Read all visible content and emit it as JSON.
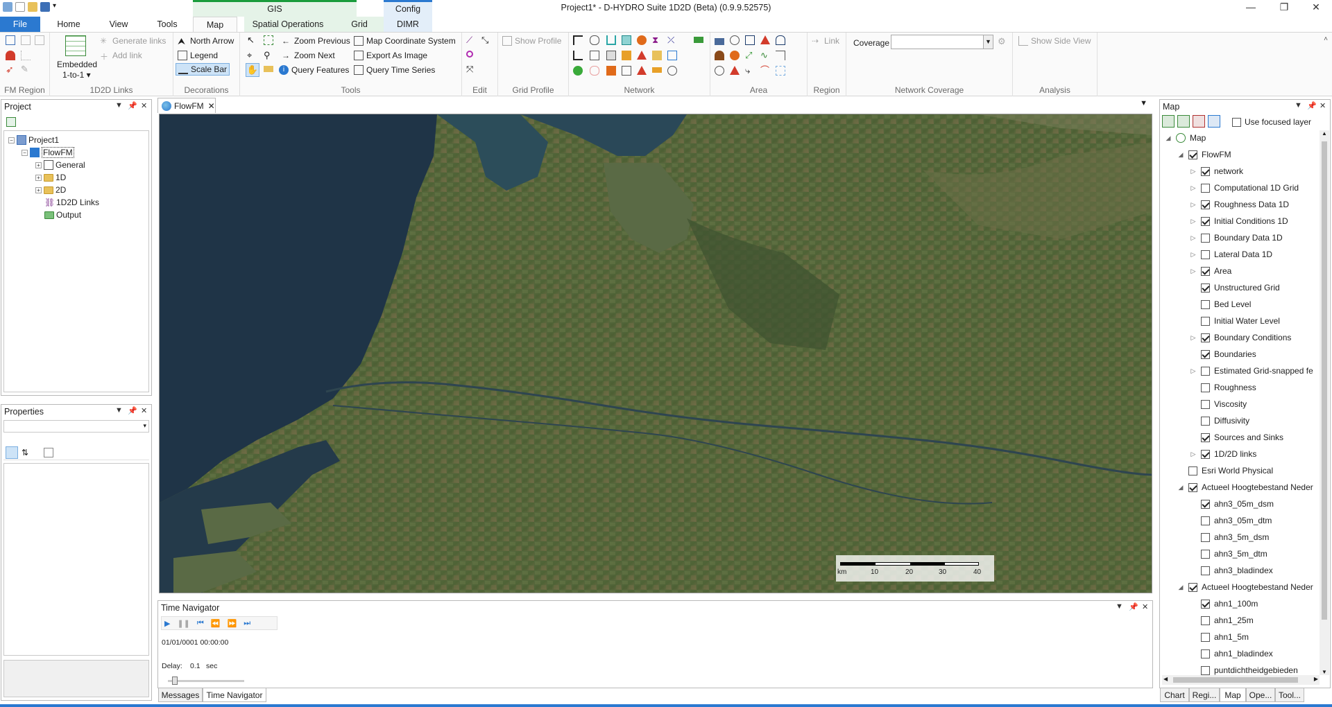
{
  "window": {
    "title": "Project1* - D-HYDRO Suite 1D2D (Beta) (0.9.9.52575)"
  },
  "contextual_heads": {
    "gis": "GIS",
    "config": "Config"
  },
  "tabs": [
    "File",
    "Home",
    "View",
    "Tools",
    "Map",
    "Spatial Operations",
    "Grid",
    "DIMR"
  ],
  "ribbon": {
    "fm_region": {
      "label": "FM Region"
    },
    "links": {
      "embedded": "Embedded",
      "mode": "1-to-1 ▾",
      "generate": "Generate links",
      "add": "Add link",
      "label": "1D2D Links"
    },
    "decorations": {
      "north_arrow": "North Arrow",
      "legend": "Legend",
      "scale_bar": "Scale Bar",
      "label": "Decorations"
    },
    "tools": {
      "zoom_previous": "Zoom Previous",
      "zoom_next": "Zoom Next",
      "query_features": "Query Features",
      "map_coordinate_system": "Map Coordinate System",
      "export_as_image": "Export As Image",
      "query_time_series": "Query Time Series",
      "label": "Tools"
    },
    "edit": {
      "label": "Edit"
    },
    "grid_profile": {
      "show_profile": "Show Profile",
      "label": "Grid Profile"
    },
    "network": {
      "label": "Network"
    },
    "area": {
      "label": "Area"
    },
    "region": {
      "link": "Link",
      "label": "Region"
    },
    "network_coverage": {
      "coverage_label": "Coverage",
      "coverage_value": "",
      "label": "Network Coverage"
    },
    "analysis": {
      "show_side_view": "Show Side View",
      "label": "Analysis"
    }
  },
  "project": {
    "title": "Project",
    "root": "Project1",
    "model": "FlowFM",
    "children": [
      "General",
      "1D",
      "2D",
      "1D2D Links",
      "Output"
    ]
  },
  "properties": {
    "title": "Properties"
  },
  "document_tab": {
    "label": "FlowFM"
  },
  "scale_bar": {
    "unit": "km",
    "ticks": [
      "10",
      "20",
      "30",
      "40"
    ]
  },
  "time_navigator": {
    "title": "Time Navigator",
    "time": "01/01/0001 00:00:00",
    "delay_label": "Delay:",
    "delay_value": "0.1",
    "delay_unit": "sec",
    "slider_fraction": 0.05
  },
  "map_panel": {
    "title": "Map",
    "use_focused_layer": "Use focused layer",
    "layers": [
      {
        "label": "Map",
        "indent": 0,
        "expander": "◢",
        "checkbox": null
      },
      {
        "label": "FlowFM",
        "indent": 1,
        "expander": "◢",
        "checkbox": true
      },
      {
        "label": "network",
        "indent": 2,
        "expander": "▷",
        "checkbox": true
      },
      {
        "label": "Computational 1D Grid",
        "indent": 2,
        "expander": "▷",
        "checkbox": false
      },
      {
        "label": "Roughness Data 1D",
        "indent": 2,
        "expander": "▷",
        "checkbox": true
      },
      {
        "label": "Initial Conditions 1D",
        "indent": 2,
        "expander": "▷",
        "checkbox": true
      },
      {
        "label": "Boundary Data 1D",
        "indent": 2,
        "expander": "▷",
        "checkbox": false
      },
      {
        "label": "Lateral Data 1D",
        "indent": 2,
        "expander": "▷",
        "checkbox": false
      },
      {
        "label": "Area",
        "indent": 2,
        "expander": "▷",
        "checkbox": true
      },
      {
        "label": "Unstructured Grid",
        "indent": 2,
        "expander": "",
        "checkbox": true
      },
      {
        "label": "Bed Level",
        "indent": 2,
        "expander": "",
        "checkbox": false
      },
      {
        "label": "Initial Water Level",
        "indent": 2,
        "expander": "",
        "checkbox": false
      },
      {
        "label": "Boundary Conditions",
        "indent": 2,
        "expander": "▷",
        "checkbox": true
      },
      {
        "label": "Boundaries",
        "indent": 2,
        "expander": "",
        "checkbox": true
      },
      {
        "label": "Estimated Grid-snapped fe",
        "indent": 2,
        "expander": "▷",
        "checkbox": false
      },
      {
        "label": "Roughness",
        "indent": 2,
        "expander": "",
        "checkbox": false
      },
      {
        "label": "Viscosity",
        "indent": 2,
        "expander": "",
        "checkbox": false
      },
      {
        "label": "Diffusivity",
        "indent": 2,
        "expander": "",
        "checkbox": false
      },
      {
        "label": "Sources and Sinks",
        "indent": 2,
        "expander": "",
        "checkbox": true
      },
      {
        "label": "1D/2D links",
        "indent": 2,
        "expander": "▷",
        "checkbox": true
      },
      {
        "label": "Esri World Physical",
        "indent": 1,
        "expander": "",
        "checkbox": false
      },
      {
        "label": "Actueel Hoogtebestand Neder",
        "indent": 1,
        "expander": "◢",
        "checkbox": true
      },
      {
        "label": "ahn3_05m_dsm",
        "indent": 2,
        "expander": "",
        "checkbox": true
      },
      {
        "label": "ahn3_05m_dtm",
        "indent": 2,
        "expander": "",
        "checkbox": false
      },
      {
        "label": "ahn3_5m_dsm",
        "indent": 2,
        "expander": "",
        "checkbox": false
      },
      {
        "label": "ahn3_5m_dtm",
        "indent": 2,
        "expander": "",
        "checkbox": false
      },
      {
        "label": "ahn3_bladindex",
        "indent": 2,
        "expander": "",
        "checkbox": false
      },
      {
        "label": "Actueel Hoogtebestand Neder",
        "indent": 1,
        "expander": "◢",
        "checkbox": true
      },
      {
        "label": "ahn1_100m",
        "indent": 2,
        "expander": "",
        "checkbox": true
      },
      {
        "label": "ahn1_25m",
        "indent": 2,
        "expander": "",
        "checkbox": false
      },
      {
        "label": "ahn1_5m",
        "indent": 2,
        "expander": "",
        "checkbox": false
      },
      {
        "label": "ahn1_bladindex",
        "indent": 2,
        "expander": "",
        "checkbox": false
      },
      {
        "label": "puntdichtheidgebieden",
        "indent": 2,
        "expander": "",
        "checkbox": false
      }
    ]
  },
  "bottom_tabs_left": [
    "Messages",
    "Time Navigator"
  ],
  "bottom_tabs_right": [
    "Chart",
    "Regi...",
    "Map",
    "Ope...",
    "Tool..."
  ],
  "colors": {
    "accent": "#2b79d0",
    "gis": "#1a9c3c",
    "config": "#2b79d0",
    "ctx_gis_bg": "#e5f3e8",
    "ctx_config_bg": "#e3eef9"
  }
}
